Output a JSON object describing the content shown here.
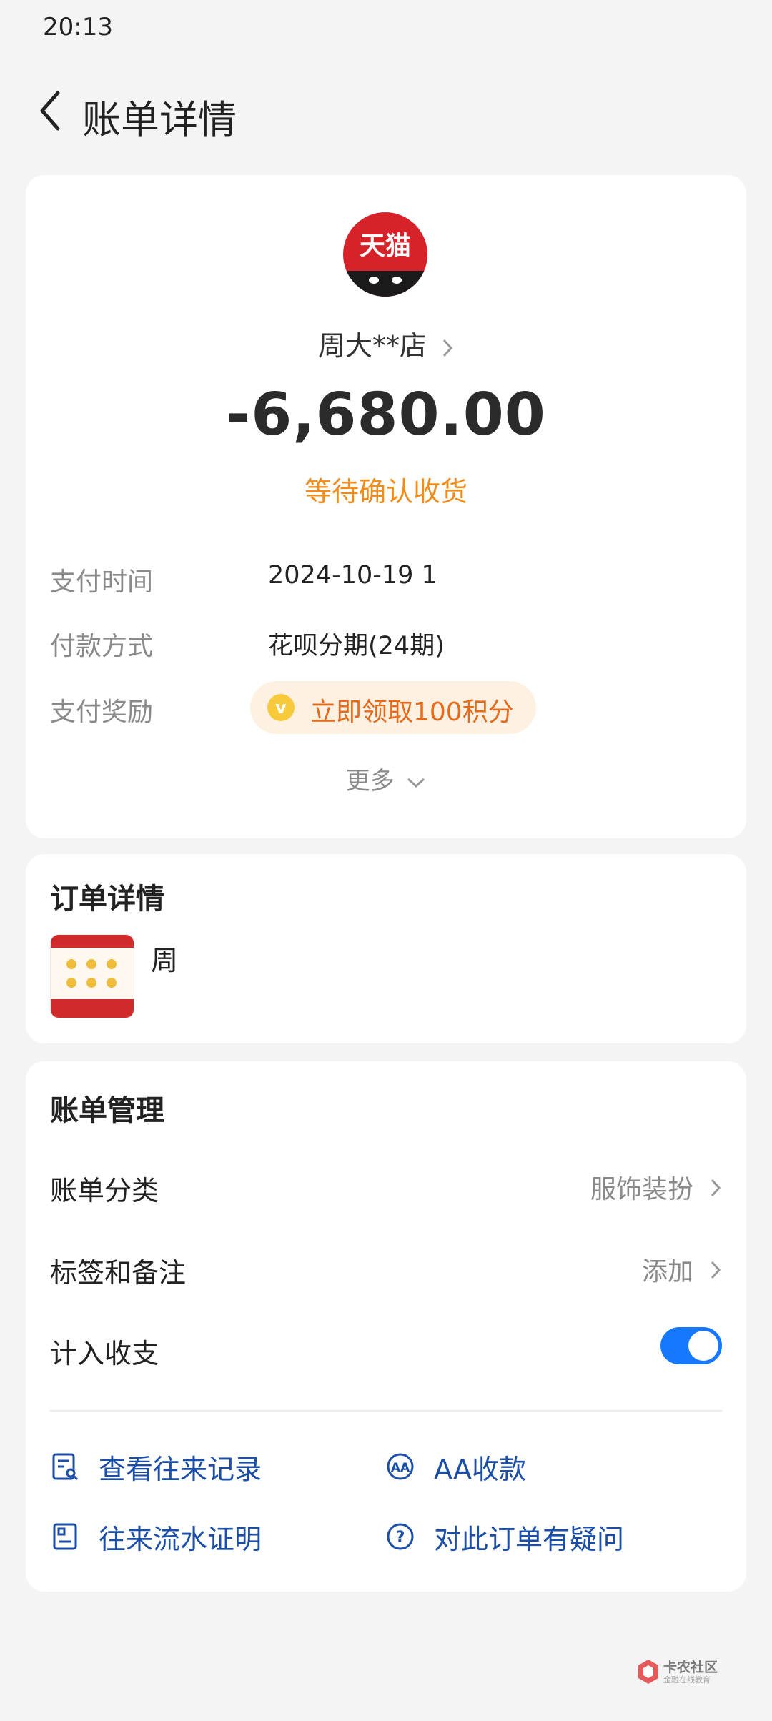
{
  "status_bar": {
    "time": "20:13"
  },
  "header": {
    "title": "账单详情"
  },
  "bill": {
    "merchant_logo_text": "天猫",
    "merchant_name": "周大**店",
    "amount": "-6,680.00",
    "status": "等待确认收货",
    "rows": [
      {
        "label": "支付时间",
        "value": "2024-10-19 1"
      },
      {
        "label": "付款方式",
        "value": "花呗分期(24期)"
      },
      {
        "label": "支付奖励",
        "value": "立即领取100积分"
      }
    ],
    "more_label": "更多"
  },
  "order": {
    "title": "订单详情",
    "product_name": "周"
  },
  "management": {
    "title": "账单管理",
    "category_label": "账单分类",
    "category_value": "服饰装扮",
    "tags_label": "标签和备注",
    "tags_value": "添加",
    "include_label": "计入收支",
    "include_on": true
  },
  "actions": {
    "history": "查看往来记录",
    "aa": "AA收款",
    "proof": "往来流水证明",
    "question": "对此订单有疑问"
  },
  "watermark": {
    "text": "卡农社区",
    "sub": "金融在线教育"
  },
  "colors": {
    "accent": "#1677ff",
    "status": "#f08c1a",
    "link": "#1a4ea8",
    "logo": "#d8222a"
  }
}
